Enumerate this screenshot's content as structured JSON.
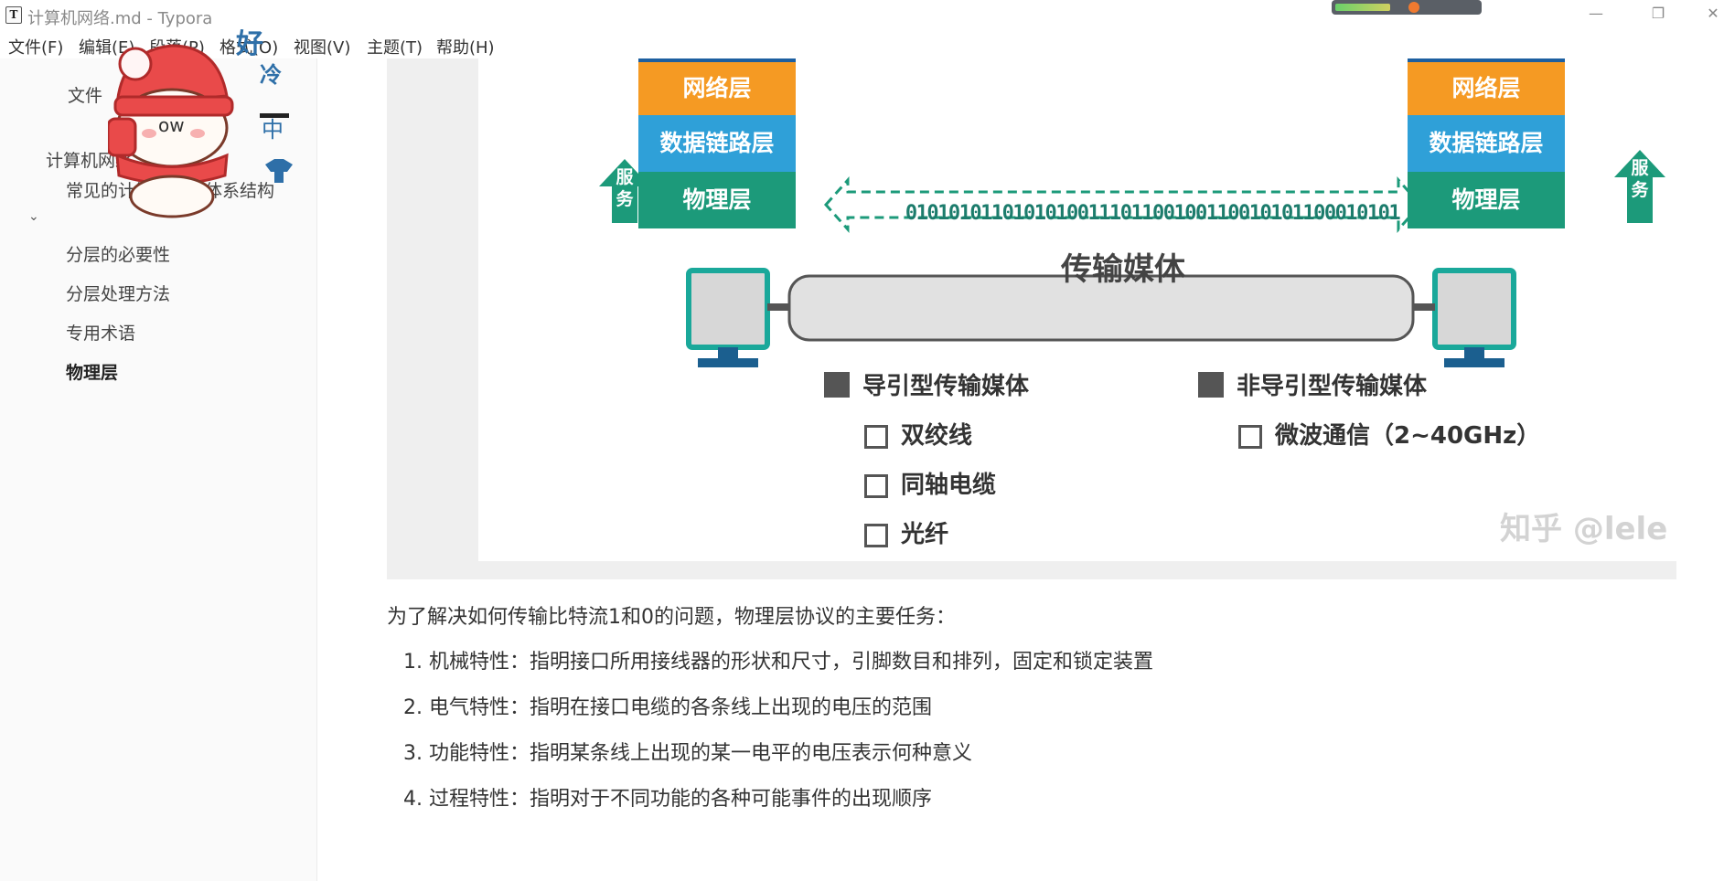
{
  "window": {
    "app_icon": "T",
    "title": "计算机网络.md - Typora",
    "minimize_icon": "minimize-icon",
    "restore_icon": "restore-icon",
    "close_icon": "close-icon"
  },
  "menubar": {
    "items": [
      "文件(F)",
      "编辑(E)",
      "段落(P)",
      "格式(O)",
      "视图(V)",
      "主题(T)",
      "帮助(H)"
    ]
  },
  "sidebar": {
    "files_label": "文件",
    "outline_root": "计算机网络",
    "items": [
      "常见的计算机网络体系结构",
      "分层的必要性",
      "分层处理方法",
      "专用术语",
      "物理层"
    ],
    "active_item": "物理层"
  },
  "sticker": {
    "chars": [
      "好",
      "冷",
      "中"
    ],
    "face": "ow"
  },
  "figure": {
    "left_stack": [
      "网络层",
      "数据链路层",
      "物理层"
    ],
    "right_stack": [
      "网络层",
      "数据链路层",
      "物理层"
    ],
    "service_label": "服务",
    "bitstream": "0101010110101010011101100100110010101100010101",
    "medium": "传输媒体",
    "guided": {
      "title": "导引型传输媒体",
      "items": [
        "双绞线",
        "同轴电缆",
        "光纤"
      ]
    },
    "unguided": {
      "title": "非导引型传输媒体",
      "items": [
        "微波通信（2~40GHz）"
      ]
    },
    "watermark": "知乎 @lele",
    "colors": {
      "orange": "#f59a23",
      "blue": "#2fa0d8",
      "green": "#1c9a7a",
      "teal": "#1aa89a"
    }
  },
  "content": {
    "intro": "为了解决如何传输比特流1和0的问题，物理层协议的主要任务：",
    "list": [
      "1. 机械特性：指明接口所用接线器的形状和尺寸，引脚数目和排列，固定和锁定装置",
      "2. 电气特性：指明在接口电缆的各条线上出现的电压的范围",
      "3. 功能特性：指明某条线上出现的某一电平的电压表示何种意义",
      "4. 过程特性：指明对于不同功能的各种可能事件的出现顺序"
    ]
  }
}
